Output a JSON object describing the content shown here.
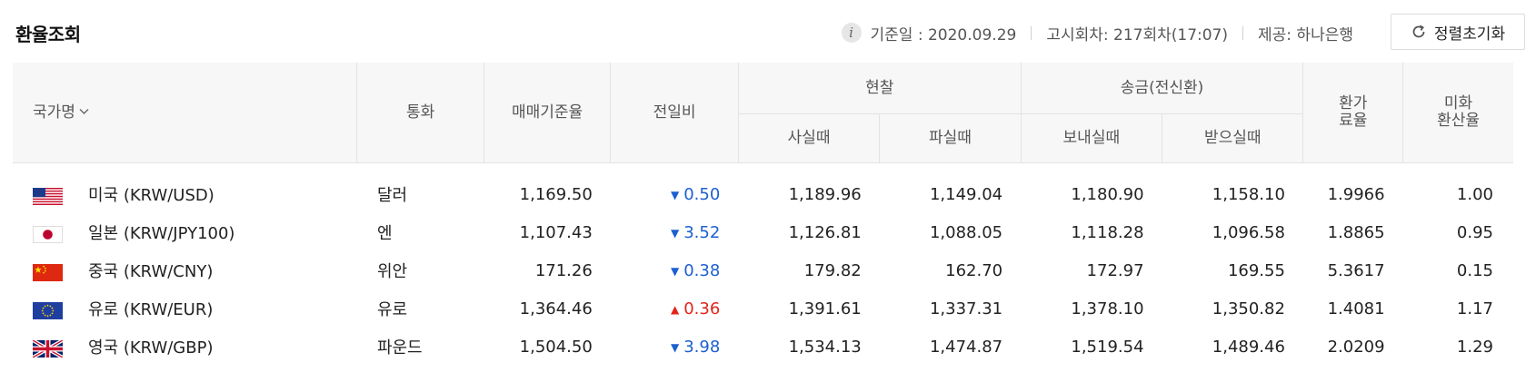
{
  "page": {
    "title": "환율조회"
  },
  "info": {
    "base_date": "기준일 : 2020.09.29",
    "notice_round": "고시회차: 217회차(17:07)",
    "provider": "제공: 하나은행",
    "info_icon": "i",
    "reset_label": "정렬초기화"
  },
  "headers": {
    "country": "국가명",
    "currency": "통화",
    "base_rate": "매매기준율",
    "change": "전일비",
    "cash": "현찰",
    "cash_buy": "사실때",
    "cash_sell": "파실때",
    "wire": "송금(전신환)",
    "wire_send": "보내실때",
    "wire_receive": "받으실때",
    "fee_rate_l1": "환가",
    "fee_rate_l2": "료율",
    "usd_rate_l1": "미화",
    "usd_rate_l2": "환산율"
  },
  "rows": [
    {
      "flag": "us-flag-icon",
      "country": "미국 (KRW/USD)",
      "currency": "달러",
      "base_rate": "1,169.50",
      "direction": "down",
      "change": "0.50",
      "cash_buy": "1,189.96",
      "cash_sell": "1,149.04",
      "wire_send": "1,180.90",
      "wire_receive": "1,158.10",
      "fee_rate": "1.9966",
      "usd_rate": "1.00"
    },
    {
      "flag": "jp-flag-icon",
      "country": "일본 (KRW/JPY100)",
      "currency": "엔",
      "base_rate": "1,107.43",
      "direction": "down",
      "change": "3.52",
      "cash_buy": "1,126.81",
      "cash_sell": "1,088.05",
      "wire_send": "1,118.28",
      "wire_receive": "1,096.58",
      "fee_rate": "1.8865",
      "usd_rate": "0.95"
    },
    {
      "flag": "cn-flag-icon",
      "country": "중국 (KRW/CNY)",
      "currency": "위안",
      "base_rate": "171.26",
      "direction": "down",
      "change": "0.38",
      "cash_buy": "179.82",
      "cash_sell": "162.70",
      "wire_send": "172.97",
      "wire_receive": "169.55",
      "fee_rate": "5.3617",
      "usd_rate": "0.15"
    },
    {
      "flag": "eu-flag-icon",
      "country": "유로 (KRW/EUR)",
      "currency": "유로",
      "base_rate": "1,364.46",
      "direction": "up",
      "change": "0.36",
      "cash_buy": "1,391.61",
      "cash_sell": "1,337.31",
      "wire_send": "1,378.10",
      "wire_receive": "1,350.82",
      "fee_rate": "1.4081",
      "usd_rate": "1.17"
    },
    {
      "flag": "gb-flag-icon",
      "country": "영국 (KRW/GBP)",
      "currency": "파운드",
      "base_rate": "1,504.50",
      "direction": "down",
      "change": "3.98",
      "cash_buy": "1,534.13",
      "cash_sell": "1,474.87",
      "wire_send": "1,519.54",
      "wire_receive": "1,489.46",
      "fee_rate": "2.0209",
      "usd_rate": "1.29"
    }
  ],
  "colors": {
    "down": "#1d5fd0",
    "up": "#e1251b",
    "header_bg": "#f7f7f7"
  }
}
